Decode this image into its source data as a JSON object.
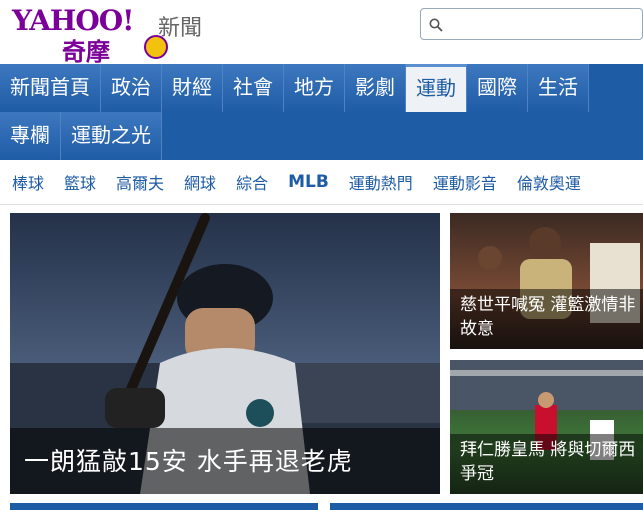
{
  "header": {
    "logo_word": "YAHOO!",
    "logo_sub": "奇摩",
    "section_name": "新聞",
    "search_placeholder": ""
  },
  "nav": {
    "row1": [
      "新聞首頁",
      "政治",
      "財經",
      "社會",
      "地方",
      "影劇",
      "運動",
      "國際",
      "生活"
    ],
    "row2": [
      "專欄",
      "運動之光"
    ],
    "active": "運動"
  },
  "subnav": [
    "棒球",
    "籃球",
    "高爾夫",
    "網球",
    "綜合",
    "MLB",
    "運動熱門",
    "運動影音",
    "倫敦奧運"
  ],
  "hero": {
    "caption": "一朗猛敲15安 水手再退老虎"
  },
  "side_stories": [
    {
      "caption": "慈世平喊冤 灌籃激情非故意"
    },
    {
      "caption": "拜仁勝皇馬 將與切爾西爭冠"
    }
  ],
  "colors": {
    "brand_purple": "#7b0099",
    "nav_blue": "#1f5ca6",
    "link_blue": "#1f5ca6"
  },
  "icons": {
    "search": "magnifier"
  }
}
